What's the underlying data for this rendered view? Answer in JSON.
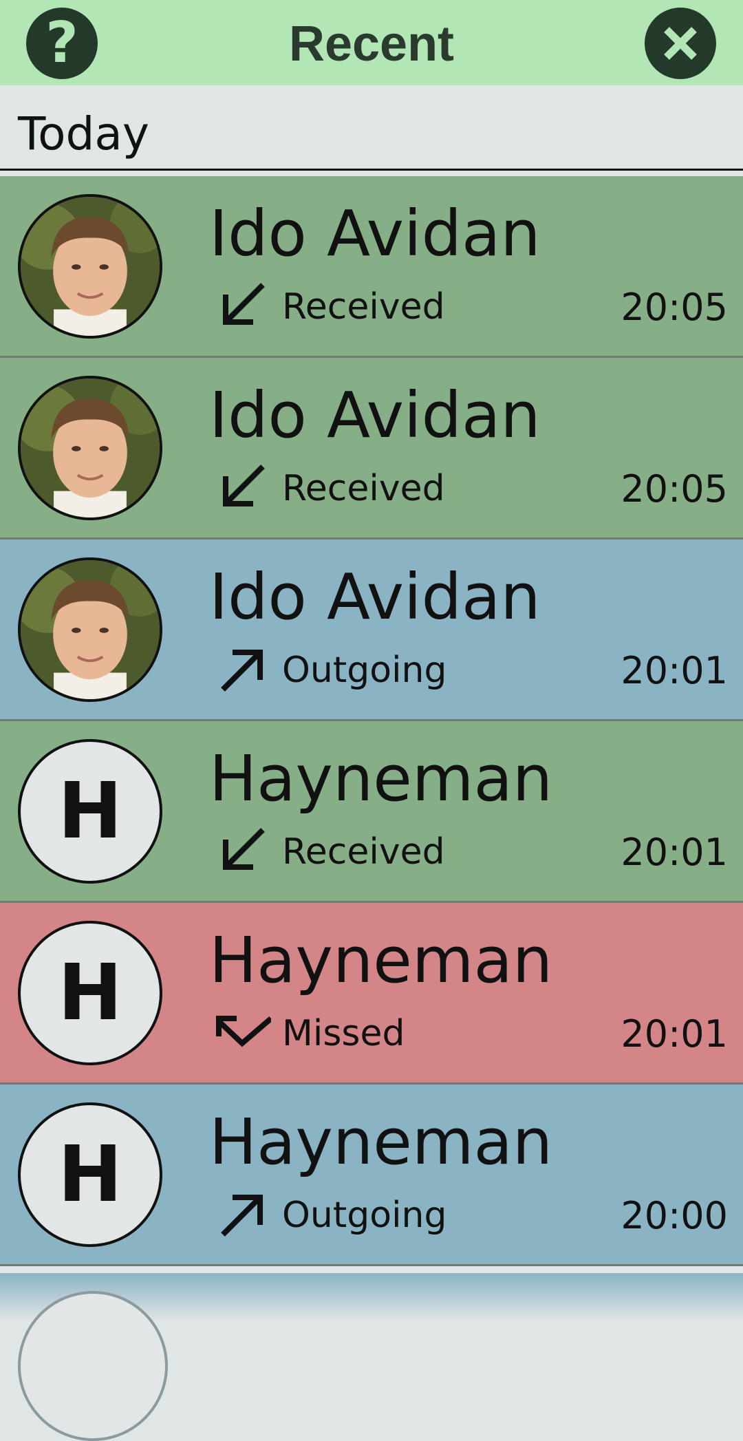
{
  "header": {
    "title": "Recent",
    "help_icon": "question-mark-icon",
    "close_icon": "close-x-icon"
  },
  "section": {
    "label": "Today"
  },
  "calls": [
    {
      "name": "Ido Avidan",
      "type": "Received",
      "time": "20:05",
      "avatar": "photo",
      "icon": "received-arrow-icon"
    },
    {
      "name": "Ido Avidan",
      "type": "Received",
      "time": "20:05",
      "avatar": "photo",
      "icon": "received-arrow-icon"
    },
    {
      "name": "Ido Avidan",
      "type": "Outgoing",
      "time": "20:01",
      "avatar": "photo",
      "icon": "outgoing-arrow-icon"
    },
    {
      "name": "Hayneman",
      "type": "Received",
      "time": "20:01",
      "avatar": "H",
      "icon": "received-arrow-icon"
    },
    {
      "name": "Hayneman",
      "type": "Missed",
      "time": "20:01",
      "avatar": "H",
      "icon": "missed-arrow-icon"
    },
    {
      "name": "Hayneman",
      "type": "Outgoing",
      "time": "20:00",
      "avatar": "H",
      "icon": "outgoing-arrow-icon"
    }
  ],
  "colors": {
    "header_bg": "#b3e6b5",
    "received_bg": "#86af88",
    "outgoing_bg": "#8ab4c3",
    "missed_bg": "#d38587",
    "section_bg": "#e0e5e6"
  }
}
